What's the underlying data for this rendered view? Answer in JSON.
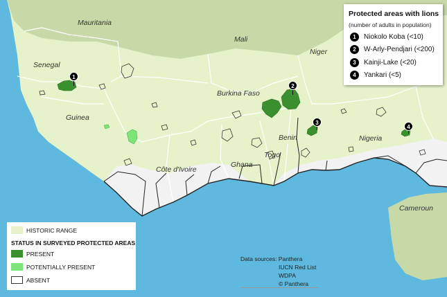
{
  "colors": {
    "ocean": "#5fb8de",
    "land": "#c8d9a8",
    "historic_range": "#e6f2c9",
    "present": "#3a8f2e",
    "potentially_present": "#7de47a",
    "absent_fill": "#ffffff",
    "desert_light": "#dfe8c6",
    "unsurveyed_south": "#f2f2f2",
    "border": "#ffffff",
    "dark_border": "#222222"
  },
  "countries": {
    "mauritania": "Mauritania",
    "mali": "Mali",
    "niger": "Niger",
    "senegal": "Senegal",
    "guinea": "Guinea",
    "burkina_faso": "Burkina Faso",
    "benin": "Benin",
    "nigeria": "Nigeria",
    "cote_divoire": "Côte d'Ivoire",
    "ghana": "Ghana",
    "togo": "Togo",
    "cameroun": "Cameroun"
  },
  "lion_areas_legend": {
    "title": "Protected areas with lions",
    "subtitle": "(number of adults in population)",
    "items": [
      {
        "number": "1",
        "label": "Niokolo Koba (<10)"
      },
      {
        "number": "2",
        "label": "W-Arly-Pendjari (<200)"
      },
      {
        "number": "3",
        "label": "Kainji-Lake (<20)"
      },
      {
        "number": "4",
        "label": "Yankari (<5)"
      }
    ]
  },
  "status_legend": {
    "historic_range": "HISTORIC RANGE",
    "heading": "STATUS IN SURVEYED PROTECTED AREAS",
    "present": "PRESENT",
    "potentially_present": "POTENTIALLY PRESENT",
    "absent": "ABSENT"
  },
  "sources": {
    "label": "Data sources: Panthera",
    "lines": [
      "IUCN Red List",
      "WDPA",
      "© Panthera"
    ]
  }
}
